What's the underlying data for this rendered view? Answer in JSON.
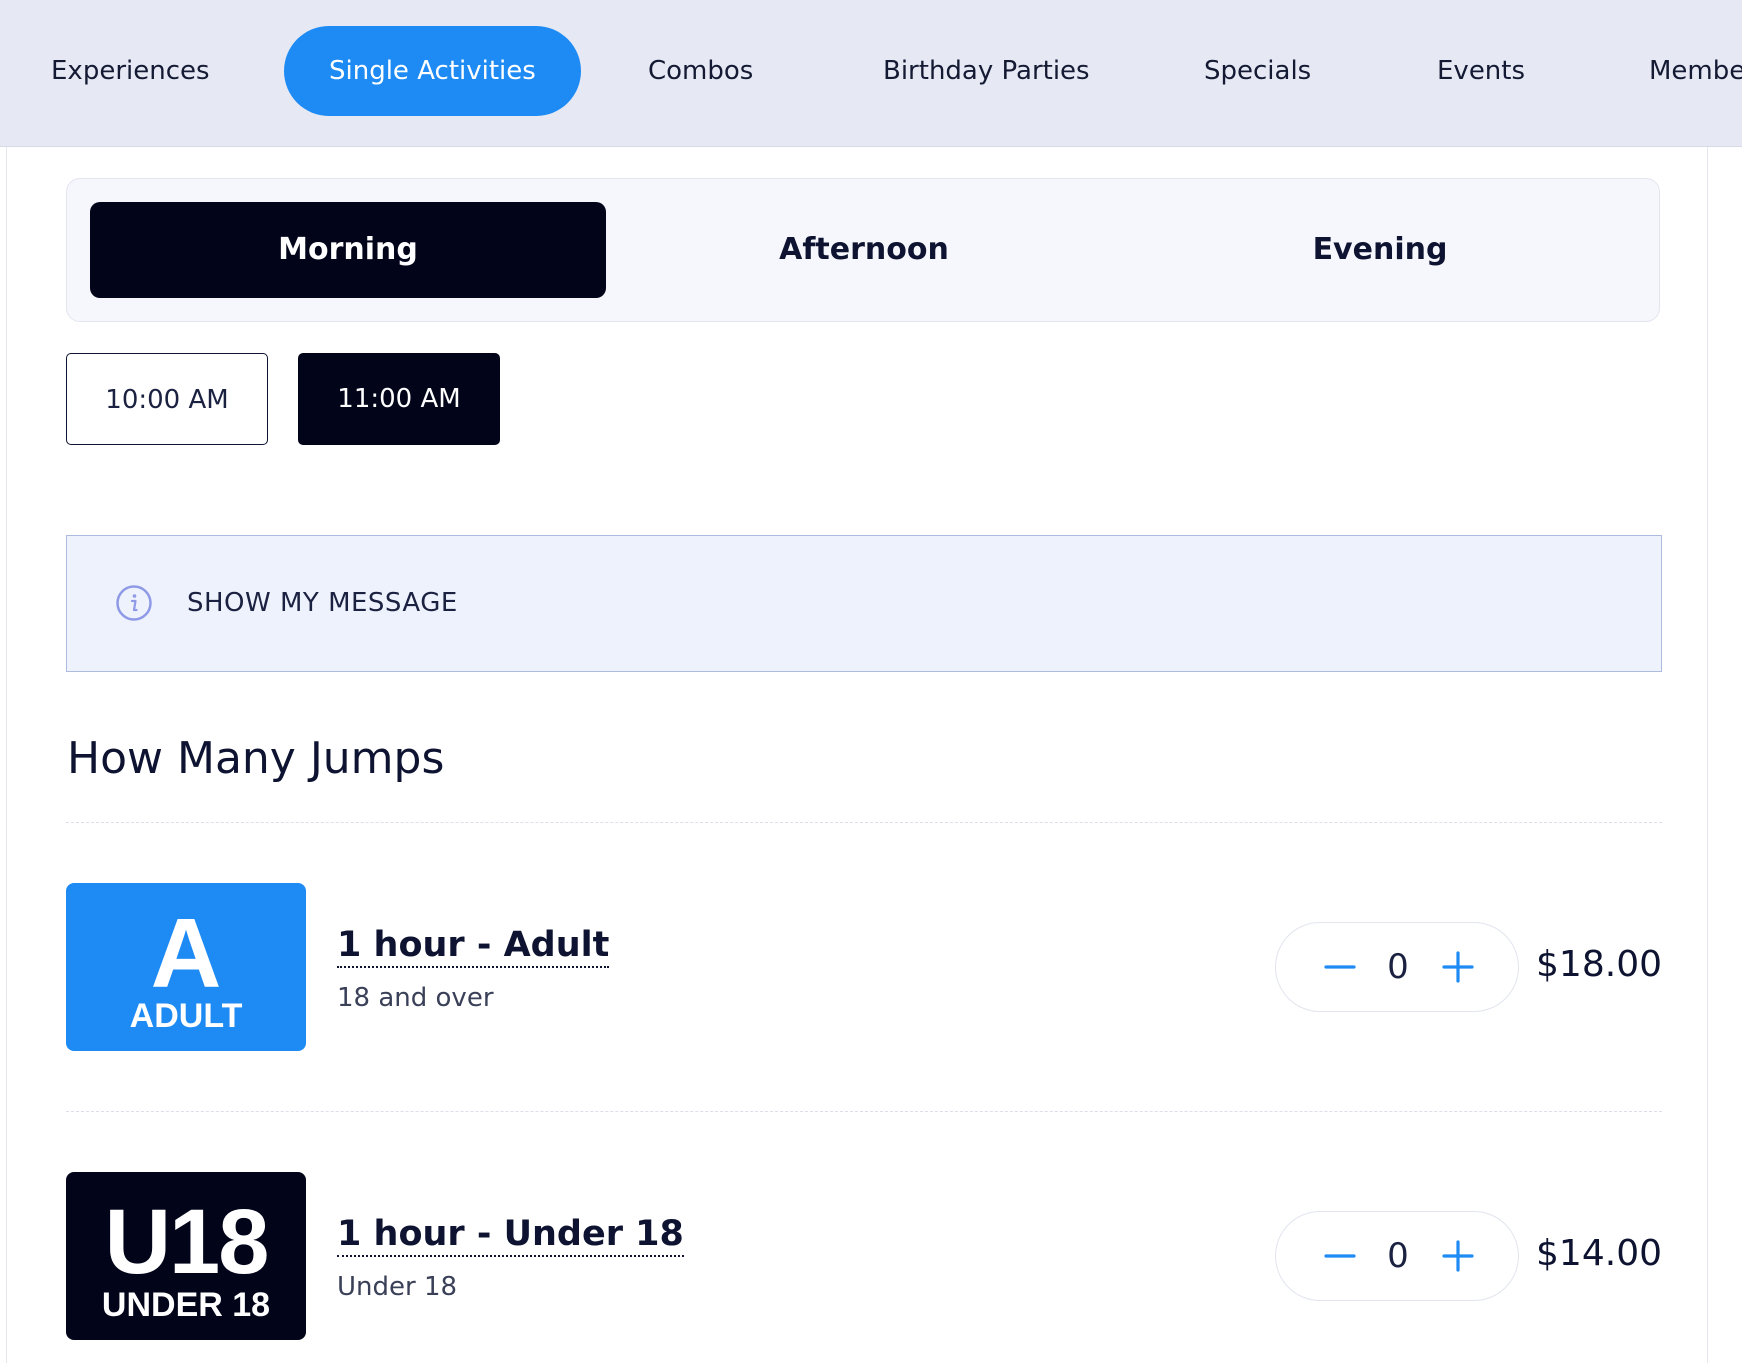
{
  "nav": {
    "tabs": [
      {
        "label": "Experiences"
      },
      {
        "label": "Single Activities"
      },
      {
        "label": "Combos"
      },
      {
        "label": "Birthday Parties"
      },
      {
        "label": "Specials"
      },
      {
        "label": "Events"
      },
      {
        "label": "Member"
      }
    ],
    "active_tab": "Single Activities",
    "accent_color": "#1e8bf5"
  },
  "periods": {
    "items": [
      {
        "label": "Morning"
      },
      {
        "label": "Afternoon"
      },
      {
        "label": "Evening"
      }
    ],
    "active": "Morning"
  },
  "time_slots": {
    "items": [
      {
        "label": "10:00 AM"
      },
      {
        "label": "11:00 AM"
      }
    ],
    "selected": "11:00 AM"
  },
  "message": {
    "icon": "info-icon",
    "text": "SHOW MY MESSAGE"
  },
  "jumps": {
    "title": "How Many Jumps",
    "tickets": [
      {
        "badge_big": "A",
        "badge_small": "ADULT",
        "badge_color": "#1e8bf5",
        "name": "1 hour - Adult",
        "description": "18 and over",
        "quantity": "0",
        "price": "$18.00"
      },
      {
        "badge_big": "U18",
        "badge_small": "UNDER 18",
        "badge_color": "#02041a",
        "name": "1 hour - Under 18",
        "description": "Under 18",
        "quantity": "0",
        "price": "$14.00"
      }
    ]
  }
}
